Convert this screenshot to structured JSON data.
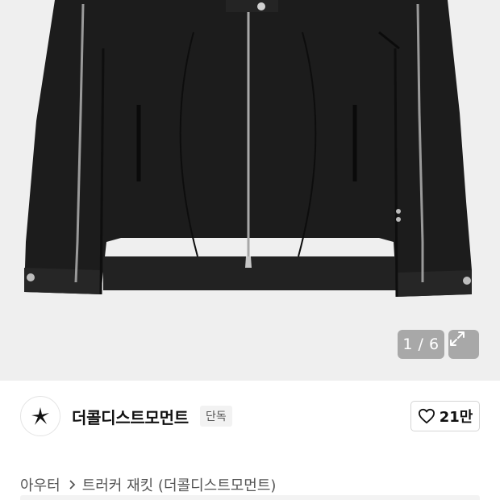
{
  "gallery": {
    "image_alt": "트러커 재킷 product photo",
    "counter": "1 / 6",
    "background_color": "#efefef",
    "icons": {
      "expand": "expand-icon"
    }
  },
  "brand": {
    "name": "더콜디스트모먼트",
    "badge": "단독",
    "logo_icon": "star-logo-icon"
  },
  "like": {
    "icon": "heart-icon",
    "count": "21만"
  },
  "breadcrumb": {
    "category": "아우터",
    "product": "트러커 재킷 (더콜디스트모먼트)",
    "separator_icon": "chevron-right-icon"
  }
}
